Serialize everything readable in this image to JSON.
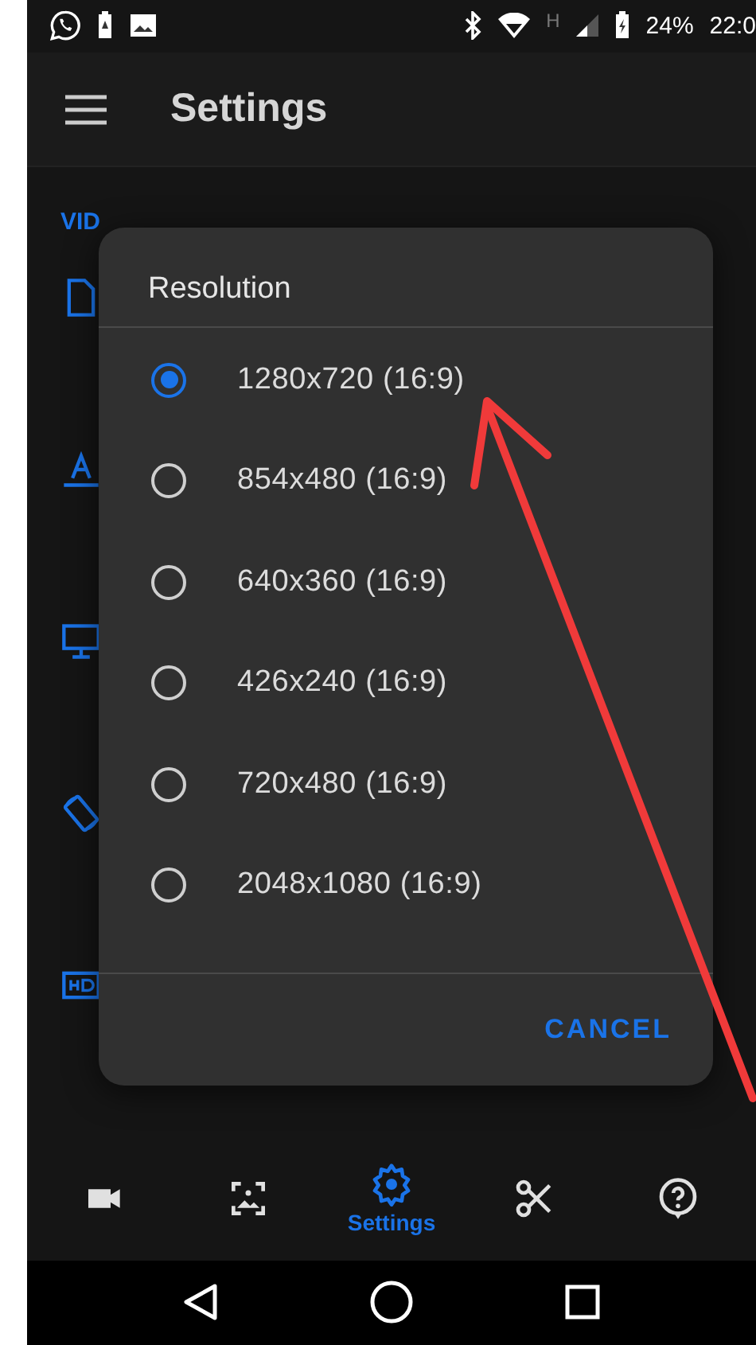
{
  "status_bar": {
    "network_type": "H",
    "battery": "24%",
    "time": "22:0"
  },
  "app_bar": {
    "title": "Settings"
  },
  "section": {
    "header": "VID",
    "items": [
      {
        "kind": "document"
      },
      {
        "kind": "text"
      },
      {
        "kind": "monitor"
      },
      {
        "kind": "rotate"
      },
      {
        "kind": "hd"
      }
    ]
  },
  "dialog": {
    "title": "Resolution",
    "options": [
      {
        "label": "1280x720 (16:9)",
        "selected": true
      },
      {
        "label": "854x480 (16:9)",
        "selected": false
      },
      {
        "label": "640x360 (16:9)",
        "selected": false
      },
      {
        "label": "426x240 (16:9)",
        "selected": false
      },
      {
        "label": "720x480 (16:9)",
        "selected": false
      },
      {
        "label": "2048x1080 (16:9)",
        "selected": false
      }
    ],
    "cancel": "CANCEL"
  },
  "bottom_nav": [
    {
      "kind": "video",
      "selected": false
    },
    {
      "kind": "image",
      "selected": false
    },
    {
      "kind": "gear",
      "label": "Settings",
      "selected": true
    },
    {
      "kind": "scissors",
      "selected": false
    },
    {
      "kind": "help",
      "selected": false
    }
  ]
}
